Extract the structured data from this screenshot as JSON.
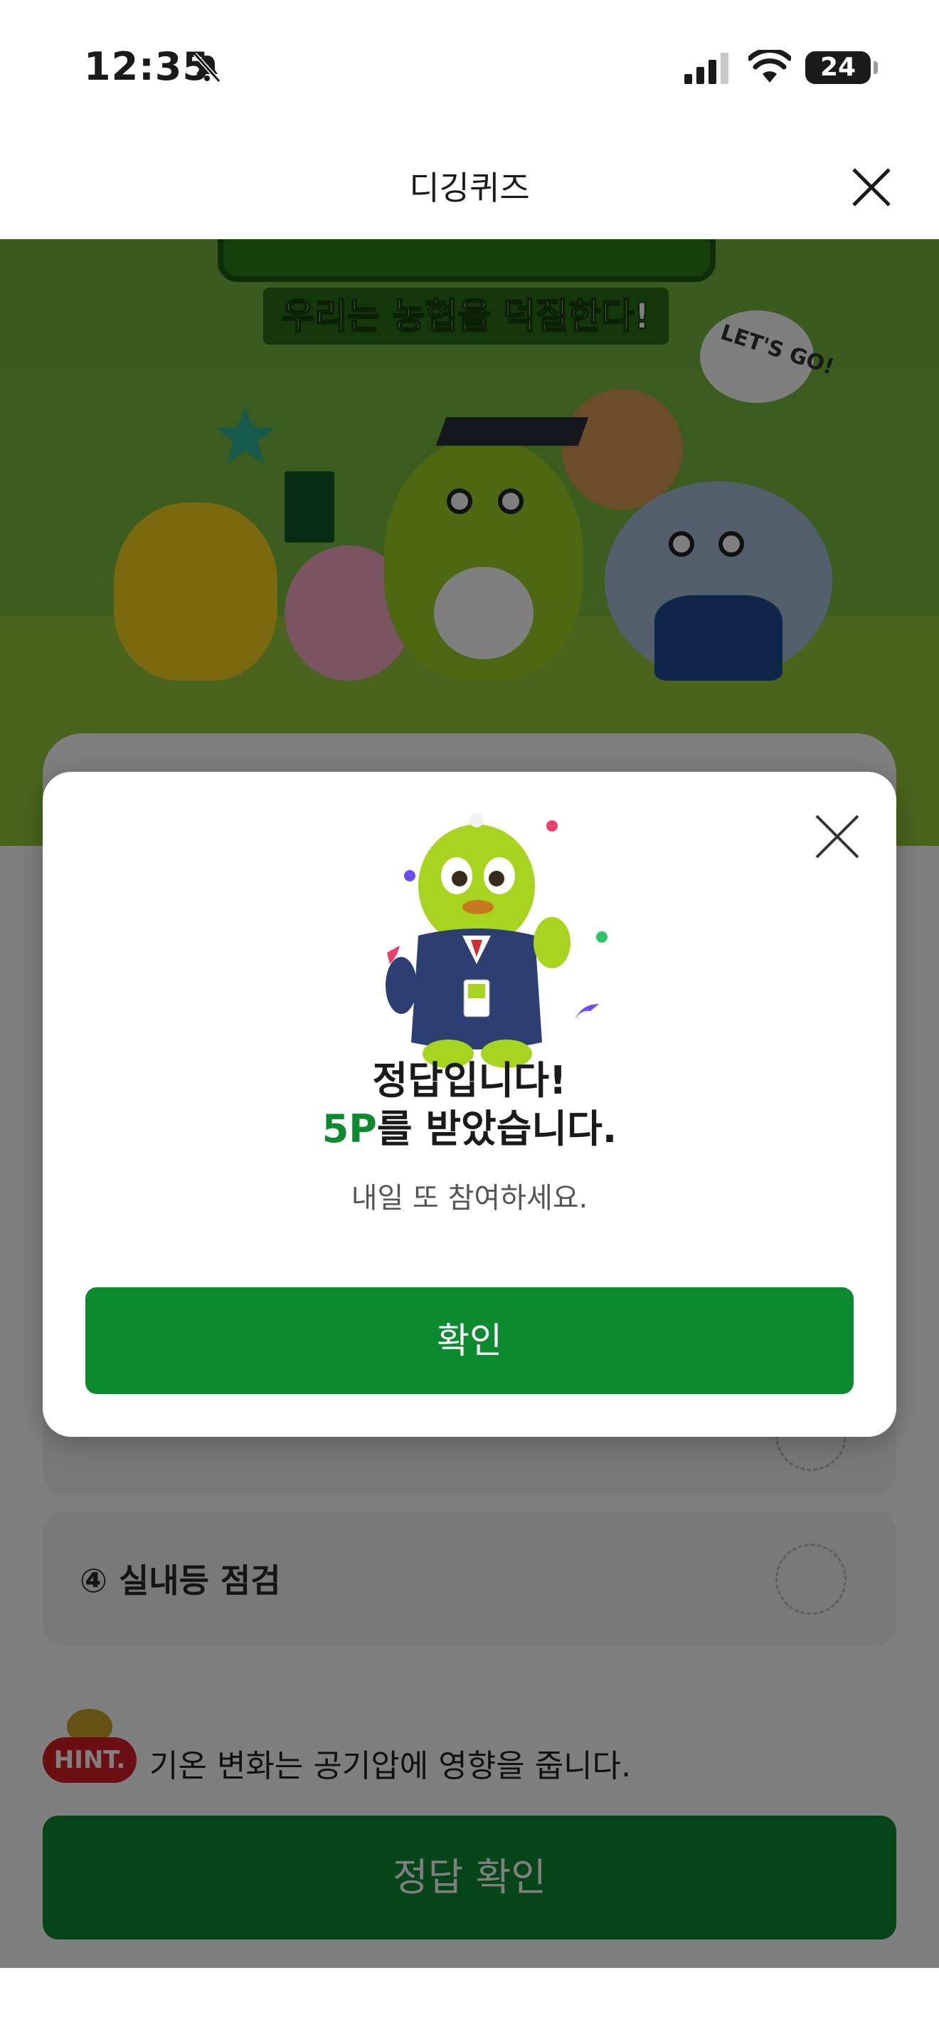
{
  "status_bar": {
    "time": "12:35",
    "battery": "24",
    "icons": [
      "bell-slash-icon",
      "signal-icon",
      "wifi-icon",
      "battery-icon"
    ]
  },
  "header": {
    "title": "디깅퀴즈",
    "close_icon": "close-icon"
  },
  "banner": {
    "subtitle": "우리는 농협을 덕질한다!",
    "speech_bubble": "LET'S GO!"
  },
  "quiz": {
    "options": [
      {
        "label": "④ 실내등 점검"
      }
    ],
    "hint_badge": "HINT.",
    "hint_text": "기온 변화는 공기압에 영향을 줍니다.",
    "submit_label": "정답 확인"
  },
  "modal": {
    "title_line1": "정답입니다!",
    "points": "5P",
    "title_line2_suffix": "를 받았습니다.",
    "subtitle": "내일 또 참여하세요.",
    "confirm_label": "확인",
    "colors": {
      "accent": "#0b8a2f"
    }
  }
}
